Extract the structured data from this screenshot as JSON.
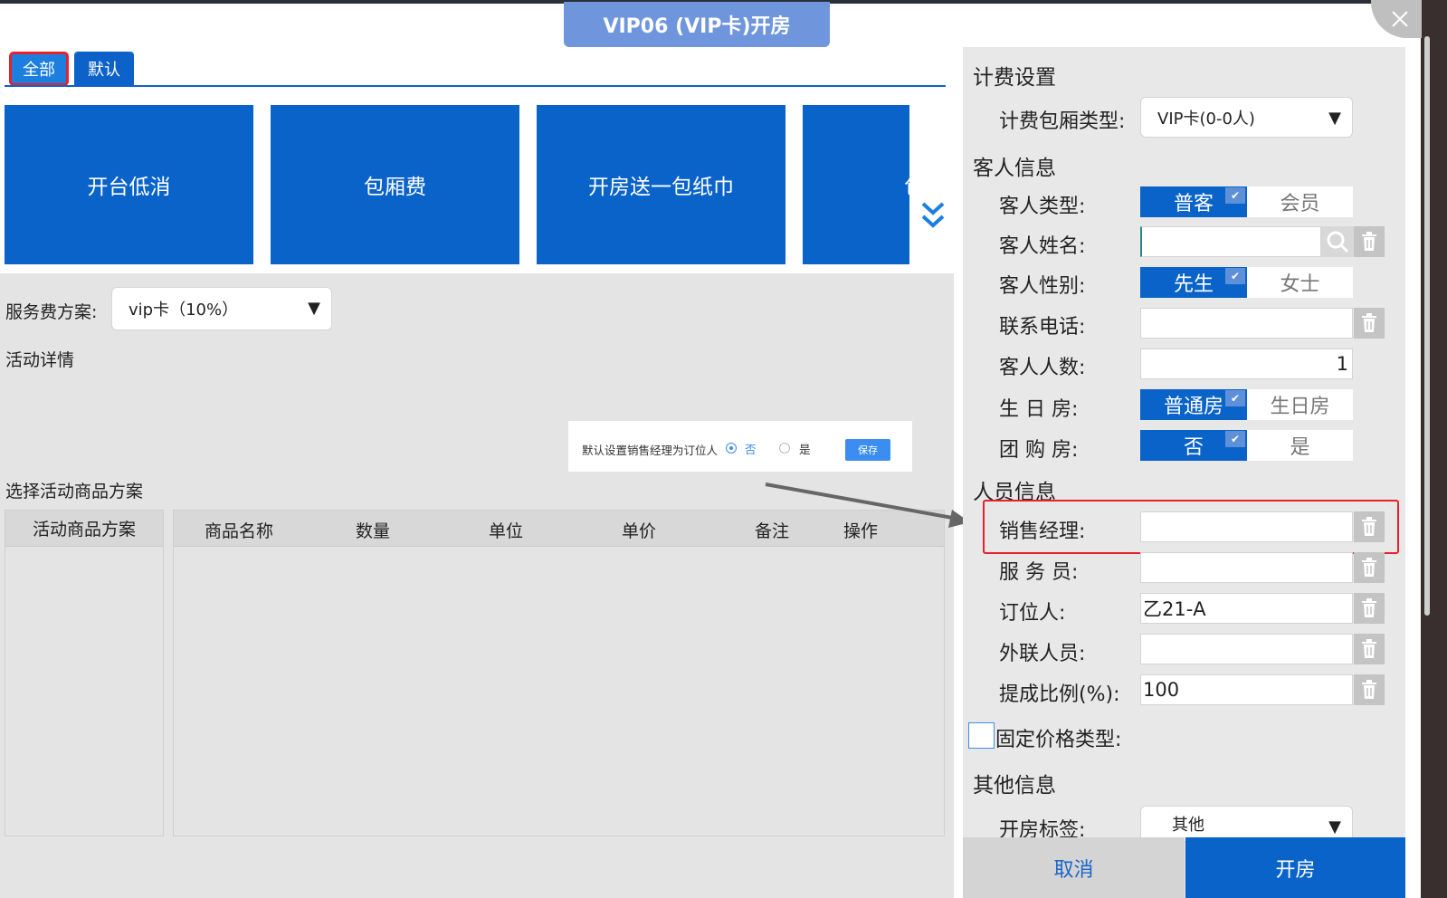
{
  "window": {
    "title": "VIP06 (VIP卡)开房"
  },
  "tabs": [
    {
      "label": "全部"
    },
    {
      "label": "默认"
    }
  ],
  "tiles": [
    {
      "label": "开台低消"
    },
    {
      "label": "包厢费"
    },
    {
      "label": "开房送一包纸巾"
    },
    {
      "label": "包"
    }
  ],
  "service": {
    "label": "服务费方案:",
    "value": "vip卡（10%）"
  },
  "activity_label": "活动详情",
  "inset": {
    "text": "默认设置销售经理为订位人",
    "no": "否",
    "yes": "是",
    "save": "保存"
  },
  "choose_label": "选择活动商品方案",
  "plan_header": "活动商品方案",
  "goods_headers": [
    "商品名称",
    "数量",
    "单位",
    "单价",
    "备注",
    "操作"
  ],
  "right": {
    "billing_title": "计费设置",
    "billing_type_label": "计费包厢类型:",
    "billing_type_value": "VIP卡(0-0人)",
    "guest_title": "客人信息",
    "guest_type_label": "客人类型:",
    "guest_type_on": "普客",
    "guest_type_off": "会员",
    "guest_name_label": "客人姓名:",
    "guest_gender_label": "客人性别:",
    "gender_on": "先生",
    "gender_off": "女士",
    "phone_label": "联系电话:",
    "count_label": "客人人数:",
    "count_value": "1",
    "birthday_label": "生 日 房:",
    "birthday_on": "普通房",
    "birthday_off": "生日房",
    "group_label": "团 购 房:",
    "group_on": "否",
    "group_off": "是",
    "staff_title": "人员信息",
    "sales_label": "销售经理:",
    "waiter_label": "服 务 员:",
    "booker_label": "订位人:",
    "booker_value": "乙21-A",
    "liaison_label": "外联人员:",
    "ratio_label": "提成比例(%):",
    "ratio_value": "100",
    "fixed_price_label": "固定价格类型:",
    "other_title": "其他信息",
    "tag_label": "开房标签:",
    "tag_value": "其他"
  },
  "buttons": {
    "cancel": "取消",
    "open": "开房"
  },
  "icons": {
    "close": "close-icon",
    "more": "double-chevron-down-icon",
    "search": "search-icon",
    "trash": "trash-icon"
  },
  "colors": {
    "primary": "#0a63c9",
    "title_bg": "#6f96dc",
    "highlight": "#e8202a"
  }
}
